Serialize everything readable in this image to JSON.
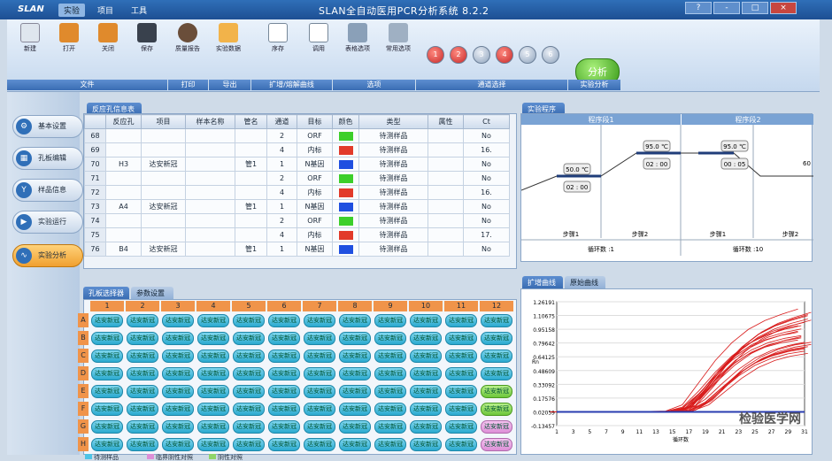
{
  "window": {
    "logo": "SLAN",
    "title": "SLAN全自动医用PCR分析系统 8.2.2",
    "menus": [
      "实验",
      "项目",
      "工具"
    ],
    "controls": [
      "?",
      "-",
      "□",
      "×"
    ]
  },
  "ribbon": {
    "buttons": [
      "新建",
      "打开",
      "关闭",
      "保存",
      "质量报告",
      "实验数据",
      "序存",
      "调用",
      "表格选项",
      "常用选项"
    ],
    "groups": [
      "文件",
      "打印",
      "导出",
      "扩增/熔解曲线",
      "选项",
      "通道选择",
      "实验分析"
    ],
    "channels": [
      "1",
      "2",
      "3",
      "4",
      "5",
      "6"
    ],
    "analyze_label": "分析"
  },
  "sidebar": {
    "items": [
      "基本设置",
      "孔板编辑",
      "样品信息",
      "实验运行",
      "实验分析"
    ]
  },
  "reaction_table": {
    "tab": "反应孔信息表",
    "headers": [
      "",
      "反应孔",
      "项目",
      "样本名称",
      "管名",
      "通道",
      "目标",
      "颜色",
      "类型",
      "属性",
      "Ct"
    ],
    "rows": [
      {
        "n": "68",
        "well": "",
        "project": "",
        "sample": "",
        "tube": "",
        "ch": "2",
        "target": "ORF",
        "color": "#3ccf2a",
        "type": "待测样品",
        "ct": "No"
      },
      {
        "n": "69",
        "well": "",
        "project": "",
        "sample": "",
        "tube": "",
        "ch": "4",
        "target": "内标",
        "color": "#e23a2a",
        "type": "待测样品",
        "ct": "16."
      },
      {
        "n": "70",
        "well": "H3",
        "project": "达安新冠",
        "sample": "",
        "tube": "管1",
        "ch": "1",
        "target": "N基因",
        "color": "#1f4fe0",
        "type": "待测样品",
        "ct": "No"
      },
      {
        "n": "71",
        "well": "",
        "project": "",
        "sample": "",
        "tube": "",
        "ch": "2",
        "target": "ORF",
        "color": "#3ccf2a",
        "type": "待测样品",
        "ct": "No"
      },
      {
        "n": "72",
        "well": "",
        "project": "",
        "sample": "",
        "tube": "",
        "ch": "4",
        "target": "内标",
        "color": "#e23a2a",
        "type": "待测样品",
        "ct": "16."
      },
      {
        "n": "73",
        "well": "A4",
        "project": "达安新冠",
        "sample": "",
        "tube": "管1",
        "ch": "1",
        "target": "N基因",
        "color": "#1f4fe0",
        "type": "待测样品",
        "ct": "No"
      },
      {
        "n": "74",
        "well": "",
        "project": "",
        "sample": "",
        "tube": "",
        "ch": "2",
        "target": "ORF",
        "color": "#3ccf2a",
        "type": "待测样品",
        "ct": "No"
      },
      {
        "n": "75",
        "well": "",
        "project": "",
        "sample": "",
        "tube": "",
        "ch": "4",
        "target": "内标",
        "color": "#e23a2a",
        "type": "待测样品",
        "ct": "17."
      },
      {
        "n": "76",
        "well": "B4",
        "project": "达安新冠",
        "sample": "",
        "tube": "管1",
        "ch": "1",
        "target": "N基因",
        "color": "#1f4fe0",
        "type": "待测样品",
        "ct": "No"
      }
    ]
  },
  "plate": {
    "tabs": [
      "孔板选择器",
      "参数设置"
    ],
    "columns": [
      "1",
      "2",
      "3",
      "4",
      "5",
      "6",
      "7",
      "8",
      "9",
      "10",
      "11",
      "12"
    ],
    "rows": [
      "A",
      "B",
      "C",
      "D",
      "E",
      "F",
      "G",
      "H"
    ],
    "cell_label": "达安新冠",
    "legend": [
      "待测样品",
      "临界阴性对照",
      "阴性对照"
    ],
    "green_cells": [
      "E12",
      "F12"
    ],
    "pink_cells": [
      "G12",
      "H12"
    ]
  },
  "program": {
    "tab": "实验程序",
    "segments": [
      "程序段1",
      "程序段2"
    ],
    "steps": [
      {
        "temp": "50.0 ℃",
        "time": "02 : 00",
        "label": "步骤1"
      },
      {
        "temp": "95.0 ℃",
        "time": "02 : 00",
        "label": "步骤2"
      },
      {
        "temp": "95.0 ℃",
        "time": "00 : 05",
        "label": "步骤1"
      },
      {
        "temp": "60",
        "time": "",
        "label": "步骤2"
      }
    ],
    "cycles": [
      "循环数 :1",
      "循环数 :10"
    ]
  },
  "amp_chart": {
    "tabs": [
      "扩增曲线",
      "原始曲线"
    ],
    "y_ticks": [
      "1.26191",
      "1.10675",
      "0.95158",
      "0.79642",
      "0.64125",
      "0.48609",
      "0.33092",
      "0.17576",
      "0.02059",
      "-0.13457"
    ],
    "x_ticks": [
      "1",
      "3",
      "5",
      "7",
      "9",
      "11",
      "13",
      "15",
      "17",
      "19",
      "21",
      "23",
      "25",
      "27",
      "29",
      "31"
    ],
    "ylabel": "Rn",
    "xlabel": "循环数",
    "watermark": "检验医学网"
  },
  "chart_data": {
    "type": "line",
    "xlabel": "循环数",
    "ylabel": "Rn",
    "ylim": [
      -0.13457,
      1.26191
    ],
    "xlim": [
      1,
      31
    ],
    "series": [
      {
        "color": "#d81b1b",
        "x": [
          1,
          5,
          10,
          15,
          17,
          19,
          21,
          23,
          25,
          27,
          29,
          31
        ],
        "values": [
          0.02,
          0.02,
          0.02,
          0.03,
          0.1,
          0.35,
          0.6,
          0.8,
          0.95,
          1.05,
          1.12,
          1.18
        ]
      },
      {
        "color": "#d81b1b",
        "x": [
          1,
          5,
          10,
          15,
          17,
          19,
          21,
          23,
          25,
          27,
          29,
          31
        ],
        "values": [
          0.02,
          0.02,
          0.02,
          0.02,
          0.05,
          0.2,
          0.42,
          0.6,
          0.72,
          0.8,
          0.85,
          0.88
        ]
      },
      {
        "color": "#d81b1b",
        "x": [
          1,
          5,
          10,
          15,
          17,
          19,
          21,
          23,
          25,
          27,
          29,
          31
        ],
        "values": [
          0.02,
          0.02,
          0.02,
          0.02,
          0.03,
          0.1,
          0.25,
          0.4,
          0.52,
          0.6,
          0.65,
          0.68
        ]
      },
      {
        "color": "#2a3db0",
        "x": [
          1,
          31
        ],
        "values": [
          0.02,
          0.02
        ]
      }
    ]
  }
}
